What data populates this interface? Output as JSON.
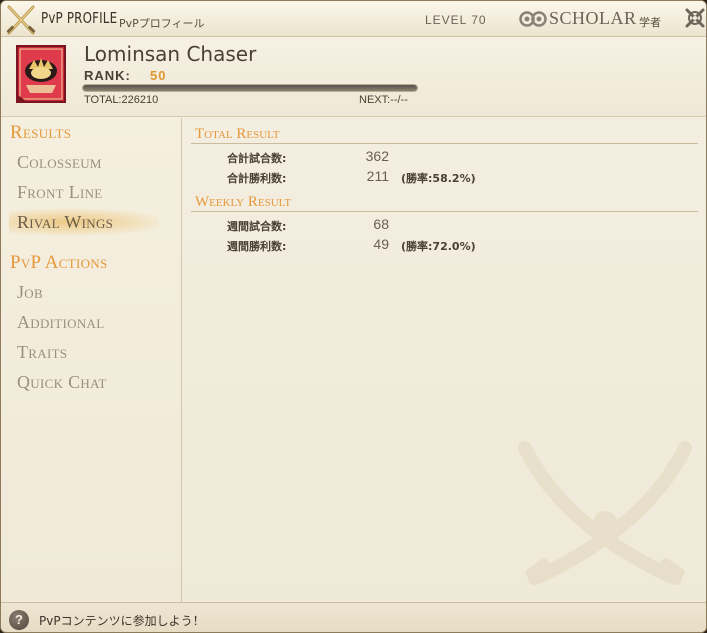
{
  "window": {
    "title": "PvP PROFILE",
    "subtitle": "PvPプロフィール",
    "level_label": "LEVEL 70",
    "job_name": "SCHOLAR",
    "job_name_ja": "学者",
    "job_icon": "scholar-icon",
    "close_icon": "close-icon"
  },
  "profile": {
    "name": "Lominsan Chaser",
    "rank_label": "RANK:",
    "rank_value": "50",
    "total_label": "TOTAL:226210",
    "next_label": "NEXT:--/--",
    "exp_progress": 1.0,
    "emblem_icon": "grand-company-emblem-icon"
  },
  "sidebar": {
    "results_title": "Results",
    "results_items": [
      {
        "label": "Colosseum",
        "active": false
      },
      {
        "label": "Front Line",
        "active": false
      },
      {
        "label": "Rival Wings",
        "active": true
      }
    ],
    "actions_title": "PvP Actions",
    "actions_items": [
      {
        "label": "Job"
      },
      {
        "label": "Additional"
      },
      {
        "label": "Traits"
      },
      {
        "label": "Quick Chat"
      }
    ]
  },
  "main": {
    "total_heading": "Total Result",
    "total_matches_label": "合計試合数:",
    "total_matches_value": "362",
    "total_wins_label": "合計勝利数:",
    "total_wins_value": "211",
    "total_win_rate": "(勝率:58.2%)",
    "weekly_heading": "Weekly Result",
    "weekly_matches_label": "週間試合数:",
    "weekly_matches_value": "68",
    "weekly_wins_label": "週間勝利数:",
    "weekly_wins_value": "49",
    "weekly_win_rate": "(勝率:72.0%)",
    "watermark_icon": "crossed-scimitars-icon"
  },
  "footer": {
    "help_icon": "help-icon",
    "help_glyph": "?",
    "message": "PvPコンテンツに参加しよう！"
  },
  "colors": {
    "accent_orange": "#e6983b",
    "rank_orange": "#e0962e",
    "background": "#f2ecdc",
    "text": "#4b4036"
  }
}
